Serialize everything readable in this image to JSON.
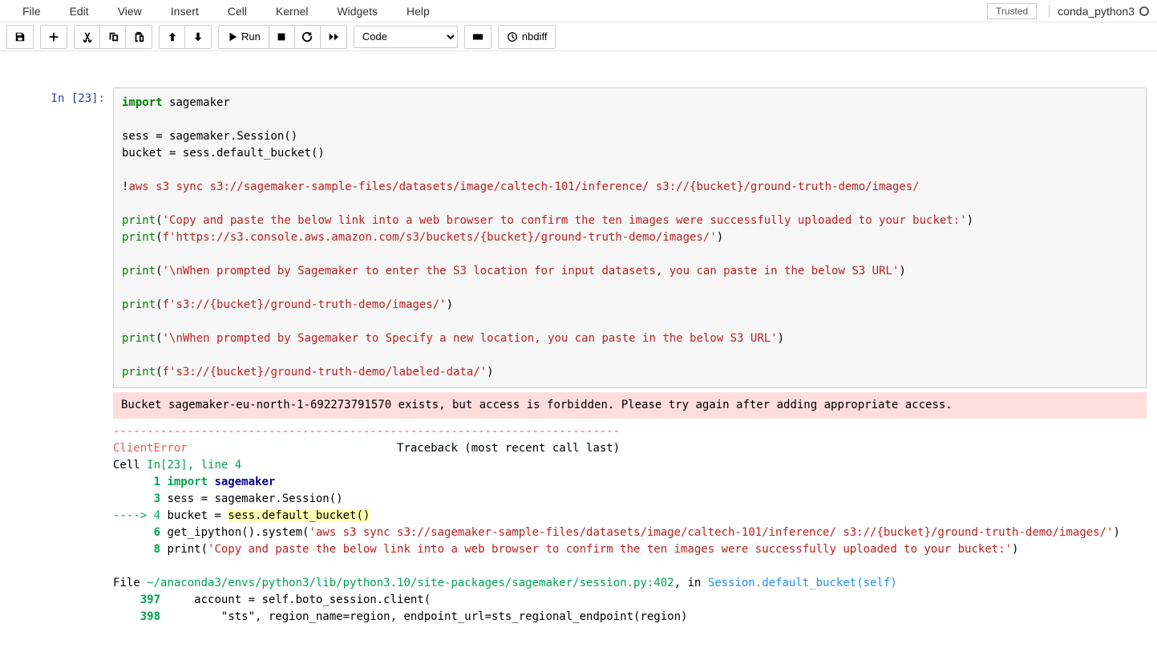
{
  "menubar": {
    "items": [
      "File",
      "Edit",
      "View",
      "Insert",
      "Cell",
      "Kernel",
      "Widgets",
      "Help"
    ],
    "trusted": "Trusted",
    "kernel": "conda_python3"
  },
  "toolbar": {
    "run_label": "Run",
    "cell_type": "Code",
    "nbdiff": "nbdiff"
  },
  "cell": {
    "prompt_label": "In ",
    "prompt_num": "[23]:",
    "code": {
      "l1_kw": "import",
      "l1_mod": " sagemaker",
      "l3": "sess = sagemaker.Session()",
      "l4": "bucket = sess.default_bucket()",
      "l6_bang": "!",
      "l6_rest": "aws s3 sync s3://sagemaker-sample-files/datasets/image/caltech-101/inference/ s3://{bucket}/ground-truth-demo/images/",
      "l8_fn": "print",
      "l8_str": "'Copy and paste the below link into a web browser to confirm the ten images were successfully uploaded to your bucket:'",
      "l9_fn": "print",
      "l9_str": "f'https://s3.console.aws.amazon.com/s3/buckets/{bucket}/ground-truth-demo/images/'",
      "l11_fn": "print",
      "l11_str": "'\\nWhen prompted by Sagemaker to enter the S3 location for input datasets, you can paste in the below S3 URL'",
      "l13_fn": "print",
      "l13_str": "f's3://{bucket}/ground-truth-demo/images/'",
      "l15_fn": "print",
      "l15_str": "'\\nWhen prompted by Sagemaker to Specify a new location, you can paste in the below S3 URL'",
      "l17_fn": "print",
      "l17_str": "f's3://{bucket}/ground-truth-demo/labeled-data/'"
    },
    "stderr": "Bucket sagemaker-eu-north-1-692273791570 exists, but access is forbidden. Please try again after adding appropriate access.\n",
    "traceback": {
      "sep": "---------------------------------------------------------------------------",
      "err_name": "ClientError",
      "tb_head": "                               Traceback (most recent call last)",
      "cell_label": "Cell ",
      "cell_loc": "In[23], line 4",
      "l1_num": "      1 ",
      "l1_kw": "import",
      "l1_sp": " ",
      "l1_mod": "sagemaker",
      "l3_num": "      3 ",
      "l3_txt": "sess = sagemaker.Session()",
      "l4_arrow": "----> 4 ",
      "l4_lhs": "bucket = ",
      "l4_hl": "sess.default_bucket()",
      "l6_num": "      6 ",
      "l6_txt1": "get_ipython().system(",
      "l6_str": "'aws s3 sync s3://sagemaker-sample-files/datasets/image/caltech-101/inference/ s3://{bucket}/ground-truth-demo/images/'",
      "l6_txt2": ")",
      "l8_num": "      8 ",
      "l8_fn": "print(",
      "l8_str": "'Copy and paste the below link into a web browser to confirm the ten images were successfully uploaded to your bucket:'",
      "l8_close": ")",
      "file_lbl": "File ",
      "file_path": "~/anaconda3/envs/python3/lib/python3.10/site-packages/sagemaker/session.py:402",
      "file_in": ", in ",
      "file_func": "Session.default_bucket(self)",
      "f397_num": "    397 ",
      "f397_txt": "    account = self.boto_session.client(",
      "f398_num": "    398 ",
      "f398_txt": "        \"sts\", region_name=region, endpoint_url=sts_regional_endpoint(region)"
    }
  }
}
